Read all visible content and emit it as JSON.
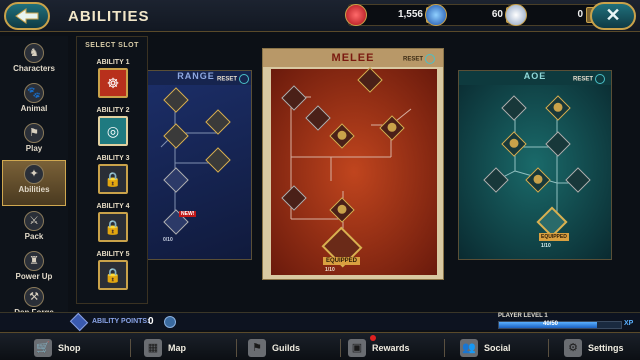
{
  "header": {
    "title": "ABILITIES",
    "back_icon": "back-arrow-icon",
    "close_icon": "close-x-icon"
  },
  "currencies": [
    {
      "name": "gems",
      "icon": "ruby-icon",
      "value": "1,556",
      "plus": "+",
      "color": "#d8242c"
    },
    {
      "name": "orbs",
      "icon": "sapphire-icon",
      "value": "60",
      "plus": "+",
      "color": "#3a7fd8"
    },
    {
      "name": "crystals",
      "icon": "diamond-icon",
      "value": "0",
      "plus": "+",
      "color": "#d8e4f0"
    }
  ],
  "close_label": "✕",
  "sidebar": {
    "items": [
      {
        "label": "Characters",
        "icon": "characters-icon",
        "glyph": "♞",
        "active": false
      },
      {
        "label": "Animal",
        "icon": "animal-icon",
        "glyph": "🐾",
        "active": false
      },
      {
        "label": "Play",
        "icon": "play-icon",
        "glyph": "⚑",
        "active": false
      },
      {
        "label": "Abilities",
        "icon": "abilities-icon",
        "glyph": "✦",
        "active": true
      },
      {
        "label": "Pack",
        "icon": "pack-icon",
        "glyph": "⚔",
        "active": false
      },
      {
        "label": "Power Up",
        "icon": "power-up-icon",
        "glyph": "♜",
        "active": false
      },
      {
        "label": "Den Forge",
        "icon": "den-forge-icon",
        "glyph": "⚒",
        "active": false
      }
    ]
  },
  "slots": {
    "header": "SELECT SLOT",
    "items": [
      {
        "label": "ABILITY 1",
        "state": "equipped",
        "icon": "melee-ability-icon",
        "glyph": "☸",
        "color": "#b8301c"
      },
      {
        "label": "ABILITY 2",
        "state": "equipped",
        "icon": "aoe-ability-icon",
        "glyph": "◎",
        "color": "#1f7a80"
      },
      {
        "label": "ABILITY 3",
        "state": "locked",
        "icon": "lock-icon",
        "glyph": "🔒",
        "color": "#2a2e36"
      },
      {
        "label": "ABILITY 4",
        "state": "locked",
        "icon": "lock-icon",
        "glyph": "🔒",
        "color": "#2a2e36"
      },
      {
        "label": "ABILITY 5",
        "state": "locked",
        "icon": "lock-icon",
        "glyph": "🔒",
        "color": "#2a2e36"
      }
    ]
  },
  "trees": {
    "reset_label": "RESET",
    "range": {
      "title": "RANGE",
      "new_badge": "NEW!",
      "progress": "0/10"
    },
    "melee": {
      "title": "MELEE",
      "equipped_badge": "EQUIPPED",
      "progress": "1/10"
    },
    "aoe": {
      "title": "AOE",
      "equipped_badge": "EQUIPPED",
      "progress": "1/10"
    }
  },
  "footer": {
    "ability_points_label": "ABILITY POINTS:",
    "ability_points_value": "0",
    "player_level_label": "PLAYER LEVEL 1",
    "xp_value": "40/50",
    "xp_progress": 0.8,
    "xp_badge": "XP"
  },
  "bottom_nav": [
    {
      "label": "Shop",
      "icon": "shop-basket-icon",
      "glyph": "🛒"
    },
    {
      "label": "Map",
      "icon": "map-icon",
      "glyph": "▦"
    },
    {
      "label": "Guilds",
      "icon": "guilds-icon",
      "glyph": "⚑"
    },
    {
      "label": "Rewards",
      "icon": "rewards-chest-icon",
      "glyph": "▣"
    },
    {
      "label": "Social",
      "icon": "social-icon",
      "glyph": "👥"
    },
    {
      "label": "Settings",
      "icon": "settings-gear-icon",
      "glyph": "⚙"
    }
  ]
}
